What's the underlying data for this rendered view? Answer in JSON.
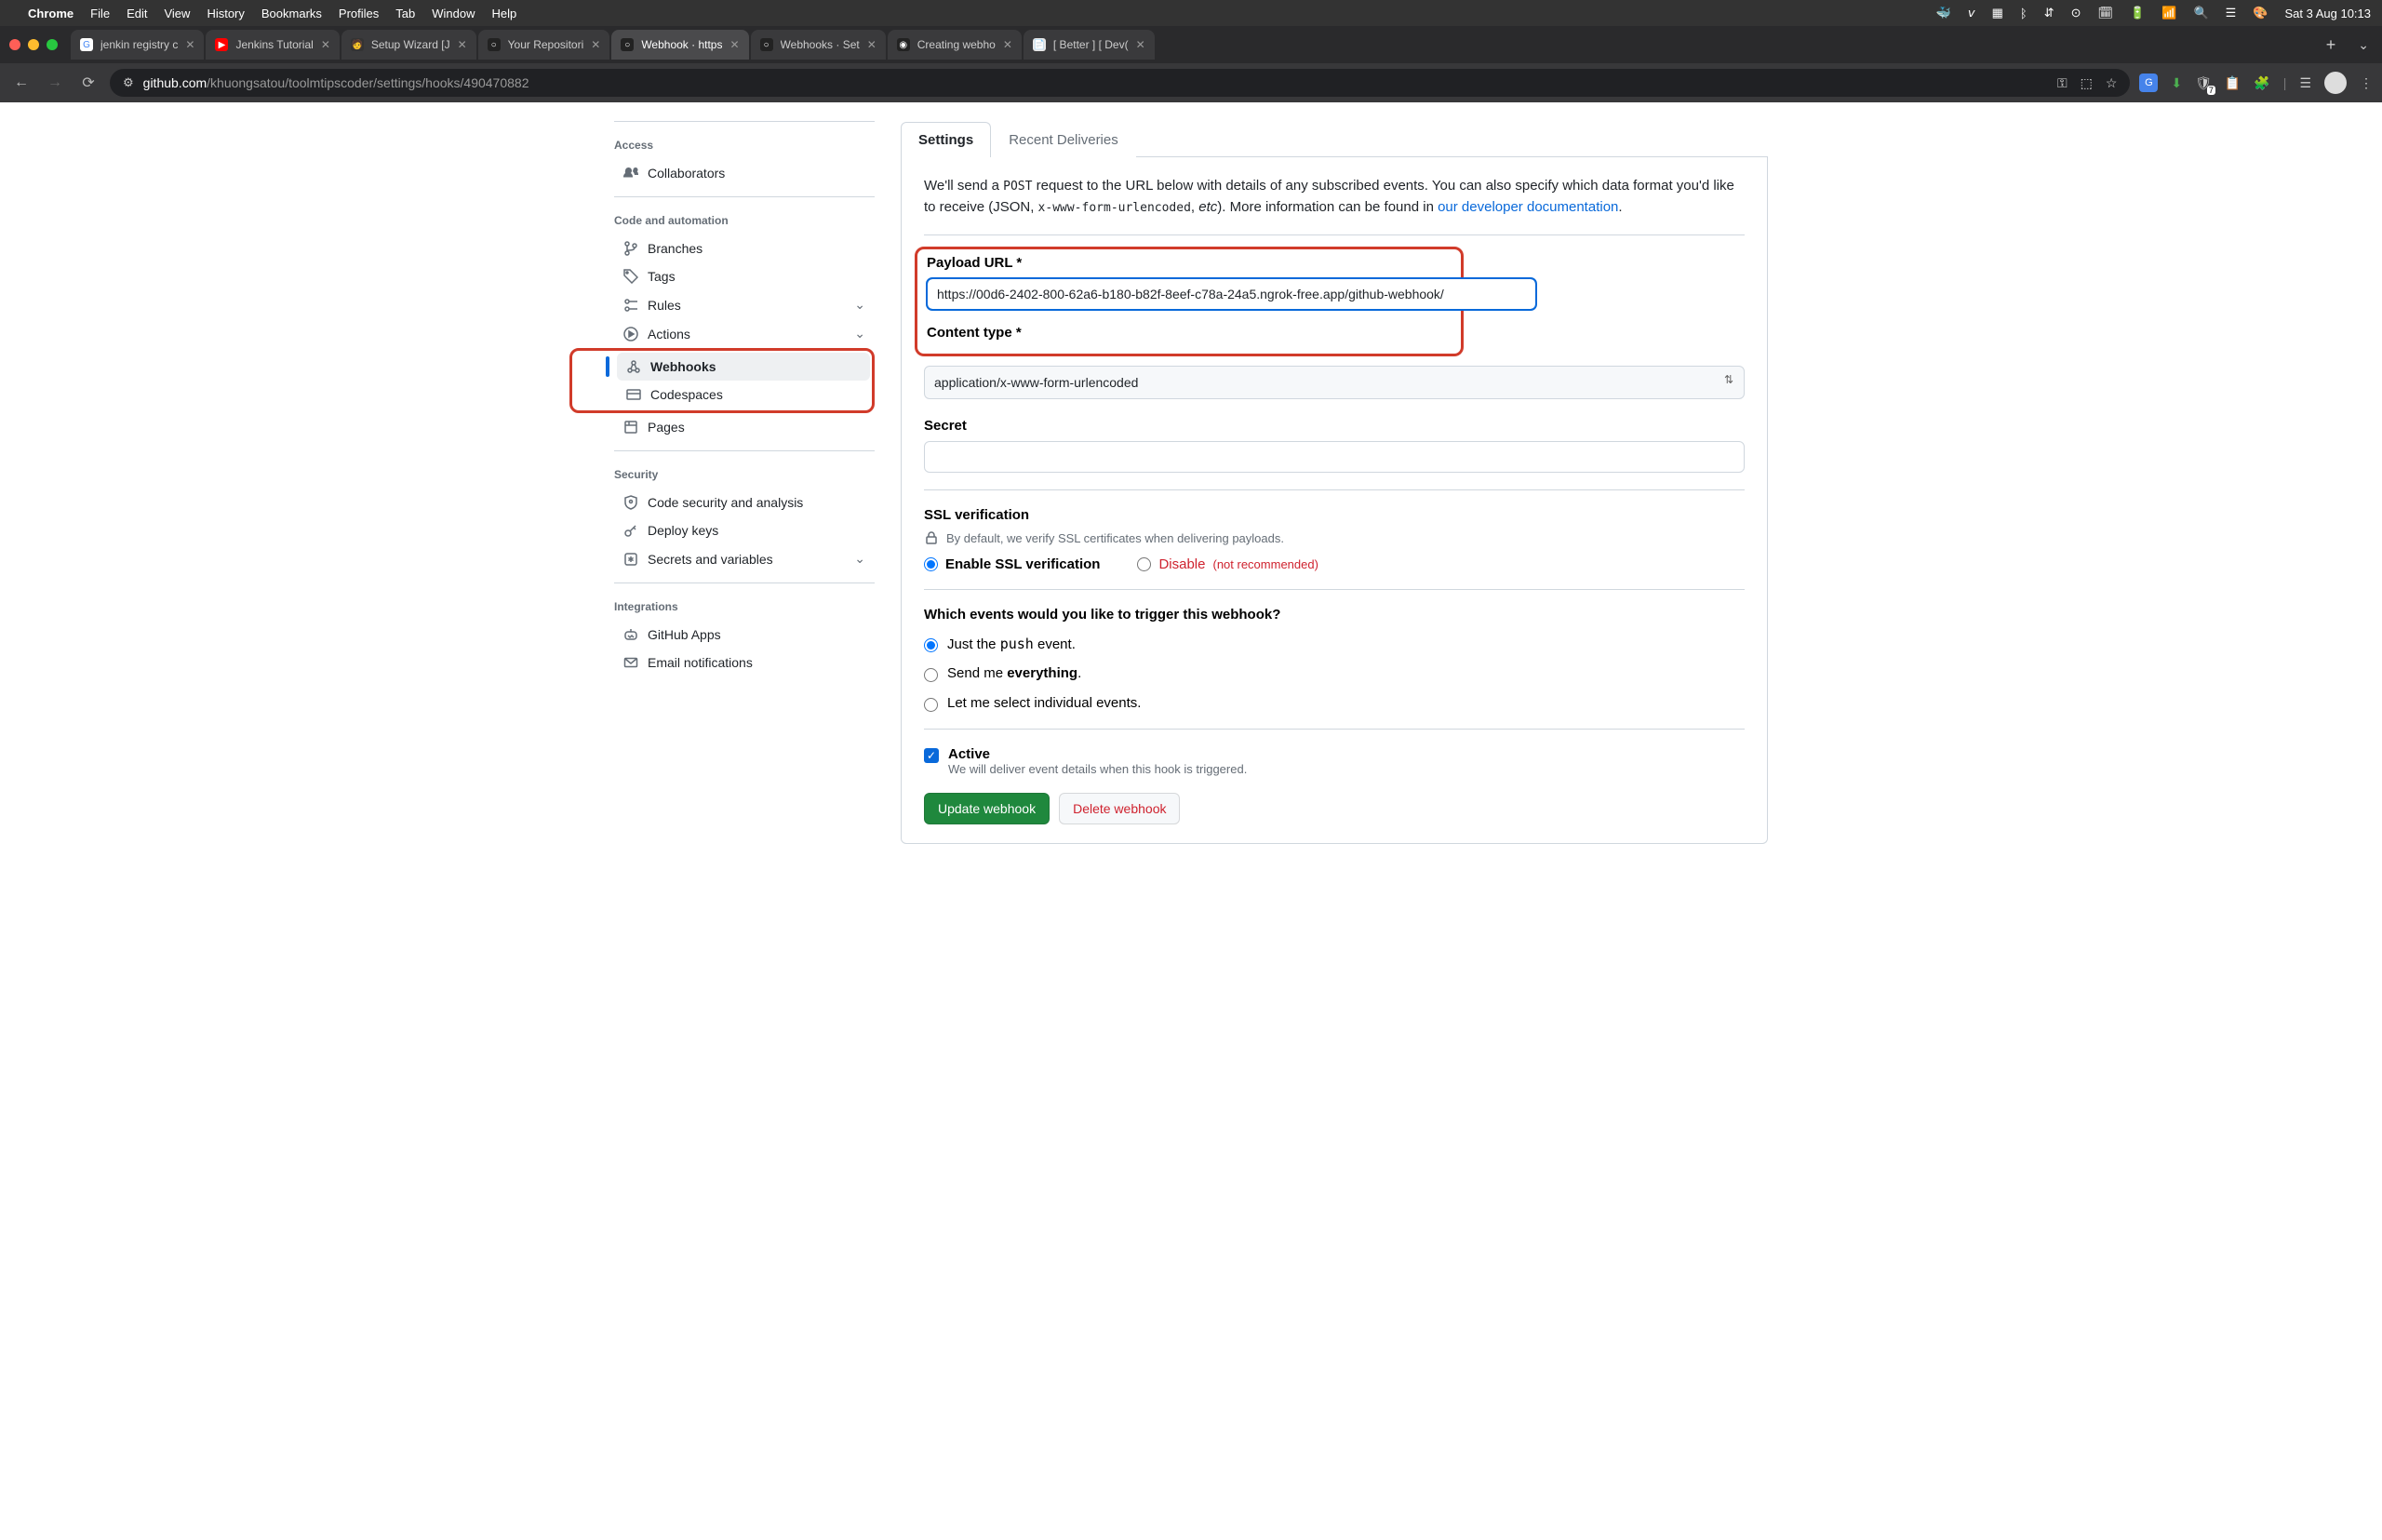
{
  "menubar": {
    "app": "Chrome",
    "items": [
      "File",
      "Edit",
      "View",
      "History",
      "Bookmarks",
      "Profiles",
      "Tab",
      "Window",
      "Help"
    ],
    "clock": "Sat 3 Aug  10:13"
  },
  "tabs": [
    {
      "title": "jenkin registry c",
      "fav": "G",
      "favbg": "#fff"
    },
    {
      "title": "Jenkins Tutorial",
      "fav": "▶",
      "favbg": "#f00"
    },
    {
      "title": "Setup Wizard [J",
      "fav": "🧑",
      "favbg": "#333"
    },
    {
      "title": "Your Repositori",
      "fav": "○",
      "favbg": "#222"
    },
    {
      "title": "Webhook · https",
      "fav": "○",
      "favbg": "#222",
      "active": true
    },
    {
      "title": "Webhooks · Set",
      "fav": "○",
      "favbg": "#222"
    },
    {
      "title": "Creating webho",
      "fav": "◉",
      "favbg": "#222"
    },
    {
      "title": "[ Better ] [ Dev(",
      "fav": "📄",
      "favbg": "#e7e7e7"
    }
  ],
  "addressbar": {
    "domain": "github.com",
    "path": "/khuongsatou/toolmtipscoder/settings/hooks/490470882"
  },
  "sidebar": {
    "groups": [
      {
        "heading": "Access",
        "items": [
          {
            "icon": "people",
            "label": "Collaborators"
          }
        ]
      },
      {
        "heading": "Code and automation",
        "items": [
          {
            "icon": "branch",
            "label": "Branches"
          },
          {
            "icon": "tag",
            "label": "Tags"
          },
          {
            "icon": "rules",
            "label": "Rules",
            "chev": true
          },
          {
            "icon": "play",
            "label": "Actions",
            "chev": true
          },
          {
            "icon": "webhook",
            "label": "Webhooks",
            "active": true
          },
          {
            "icon": "codespaces",
            "label": "Codespaces"
          },
          {
            "icon": "pages",
            "label": "Pages"
          }
        ]
      },
      {
        "heading": "Security",
        "items": [
          {
            "icon": "shield",
            "label": "Code security and analysis"
          },
          {
            "icon": "key",
            "label": "Deploy keys"
          },
          {
            "icon": "asterisk",
            "label": "Secrets and variables",
            "chev": true
          }
        ]
      },
      {
        "heading": "Integrations",
        "items": [
          {
            "icon": "ghapps",
            "label": "GitHub Apps"
          },
          {
            "icon": "mail",
            "label": "Email notifications"
          }
        ]
      }
    ]
  },
  "main": {
    "tabs": {
      "settings": "Settings",
      "recent": "Recent Deliveries"
    },
    "info_pre": "We'll send a ",
    "info_post_code": "POST",
    "info_mid": " request to the URL below with details of any subscribed events. You can also specify which data format you'd like to receive (JSON, ",
    "info_code2": "x-www-form-urlencoded",
    "info_mid2": ", ",
    "info_em": "etc",
    "info_mid3": "). More information can be found in ",
    "info_link": "our developer documentation",
    "info_end": ".",
    "payload_label": "Payload URL *",
    "payload_value": "https://00d6-2402-800-62a6-b180-b82f-8eef-c78a-24a5.ngrok-free.app/github-webhook/",
    "ctype_label": "Content type *",
    "ctype_value": "application/x-www-form-urlencoded",
    "secret_label": "Secret",
    "secret_value": "",
    "ssl_heading": "SSL verification",
    "ssl_note": "By default, we verify SSL certificates when delivering payloads.",
    "ssl_enable": "Enable SSL verification",
    "ssl_disable": "Disable",
    "ssl_notrec": "(not recommended)",
    "events_heading": "Which events would you like to trigger this webhook?",
    "ev_push_pre": "Just the ",
    "ev_push_code": "push",
    "ev_push_post": " event.",
    "ev_everything_pre": "Send me ",
    "ev_everything_strong": "everything",
    "ev_everything_post": ".",
    "ev_individual": "Let me select individual events.",
    "active_label": "Active",
    "active_note": "We will deliver event details when this hook is triggered.",
    "btn_update": "Update webhook",
    "btn_delete": "Delete webhook"
  },
  "ext_badge_count": "7"
}
